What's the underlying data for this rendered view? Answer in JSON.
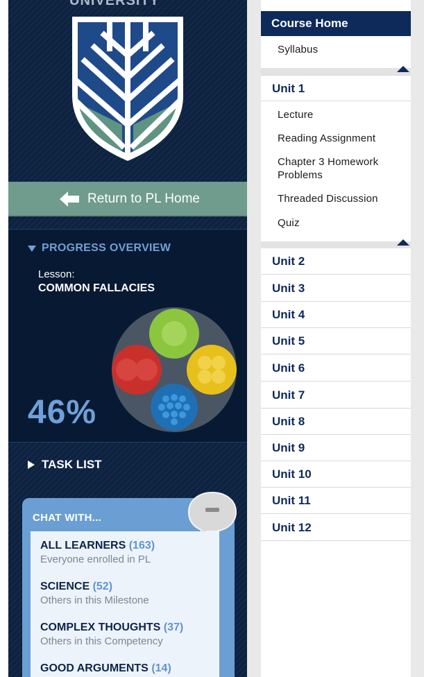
{
  "sidebar": {
    "return_label": "Return to PL Home",
    "progress": {
      "title": "PROGRESS OVERVIEW",
      "lesson_label": "Lesson:",
      "lesson_name": "COMMON FALLACIES",
      "percent_text": "46%",
      "orb_colors": [
        "#8cc63f",
        "#e8c01c",
        "#c9302c",
        "#2a8bd1"
      ]
    },
    "task_list_label": "TASK LIST",
    "chat": {
      "title": "CHAT WITH...",
      "items": [
        {
          "name": "ALL LEARNERS",
          "count": "(163)",
          "desc": "Everyone enrolled in PL"
        },
        {
          "name": "SCIENCE",
          "count": "(52)",
          "desc": "Others in this Milestone"
        },
        {
          "name": "COMPLEX THOUGHTS",
          "count": "(37)",
          "desc": "Others in this Competency"
        },
        {
          "name": "GOOD ARGUMENTS",
          "count": "(14)",
          "desc": ""
        }
      ]
    }
  },
  "nav": {
    "course_home": "Course Home",
    "syllabus": "Syllabus",
    "unit1": {
      "label": "Unit 1",
      "items": [
        "Lecture",
        "Reading Assignment",
        "Chapter 3 Homework Problems",
        "Threaded Discussion",
        "Quiz"
      ]
    },
    "units": [
      "Unit 2",
      "Unit 3",
      "Unit 4",
      "Unit 5",
      "Unit 6",
      "Unit 7",
      "Unit 8",
      "Unit 9",
      "Unit 10",
      "Unit 11",
      "Unit 12"
    ]
  },
  "colors": {
    "navy": "#0d2a5a",
    "sidebar_bg": "#0c2240",
    "return_green": "#6f9c8c",
    "accent_blue": "#6fa0d8"
  }
}
